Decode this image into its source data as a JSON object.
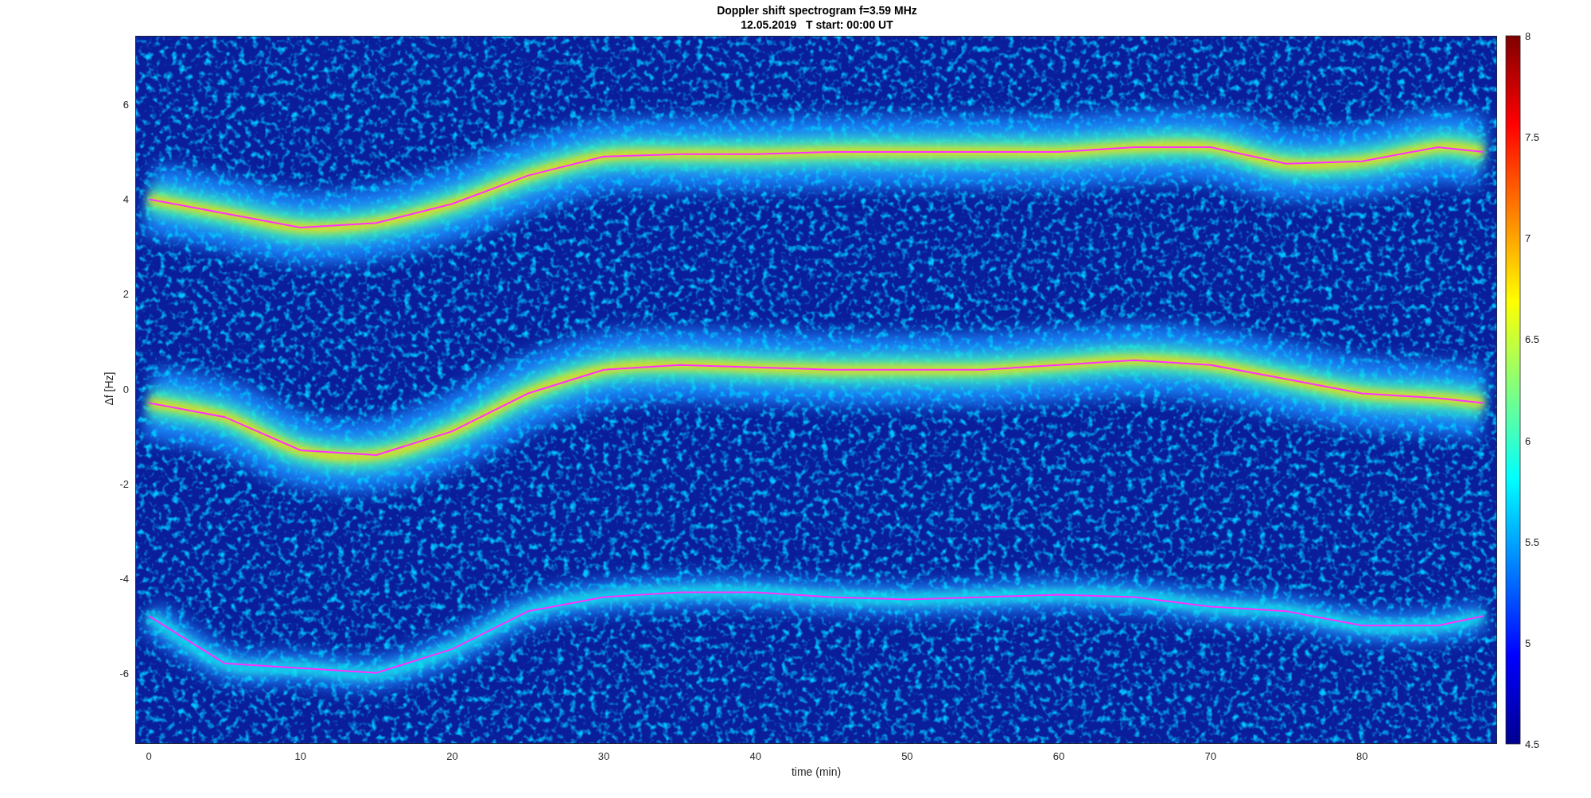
{
  "figure": {
    "title": [
      "Doppler shift spectrogram f=3.59 MHz",
      "12.05.2019   T start: 00:00 UT"
    ],
    "colorbar": {
      "ticks": [
        "8",
        "7.5",
        "7",
        "6.5",
        "6",
        "5.5",
        "5",
        "4.5"
      ]
    },
    "chart_data": {
      "type": "line",
      "xlabel": "time (min)",
      "ylabel": "Δf [Hz]",
      "xlim": [
        -0.9,
        88.9
      ],
      "ylim": [
        -7.5,
        7.45
      ],
      "xticks": [
        0,
        10,
        20,
        30,
        40,
        50,
        60,
        70,
        80
      ],
      "yticks": [
        -6,
        -4,
        -2,
        0,
        2,
        4,
        6
      ],
      "x": [
        0,
        5,
        10,
        15,
        20,
        25,
        30,
        35,
        40,
        45,
        50,
        55,
        60,
        65,
        70,
        75,
        80,
        85,
        88
      ],
      "series": [
        {
          "color": "#ff30ff",
          "values": [
            4,
            3.7,
            3.4,
            3.5,
            3.9,
            4.5,
            4.9,
            4.95,
            4.95,
            5,
            5,
            5,
            5,
            5.1,
            5.1,
            4.75,
            4.8,
            5.1,
            5
          ]
        },
        {
          "color": "#ff30ff",
          "values": [
            -0.3,
            -0.6,
            -1.3,
            -1.4,
            -0.9,
            -0.1,
            0.4,
            0.5,
            0.45,
            0.4,
            0.4,
            0.4,
            0.5,
            0.6,
            0.5,
            0.2,
            -0.1,
            -0.2,
            -0.3
          ]
        },
        {
          "color": "#ff30ff",
          "values": [
            -4.8,
            -5.8,
            -5.9,
            -6,
            -5.5,
            -4.7,
            -4.4,
            -4.3,
            -4.3,
            -4.4,
            -4.45,
            -4.4,
            -4.35,
            -4.4,
            -4.6,
            -4.7,
            -5,
            -5,
            -4.8
          ]
        }
      ]
    }
  }
}
